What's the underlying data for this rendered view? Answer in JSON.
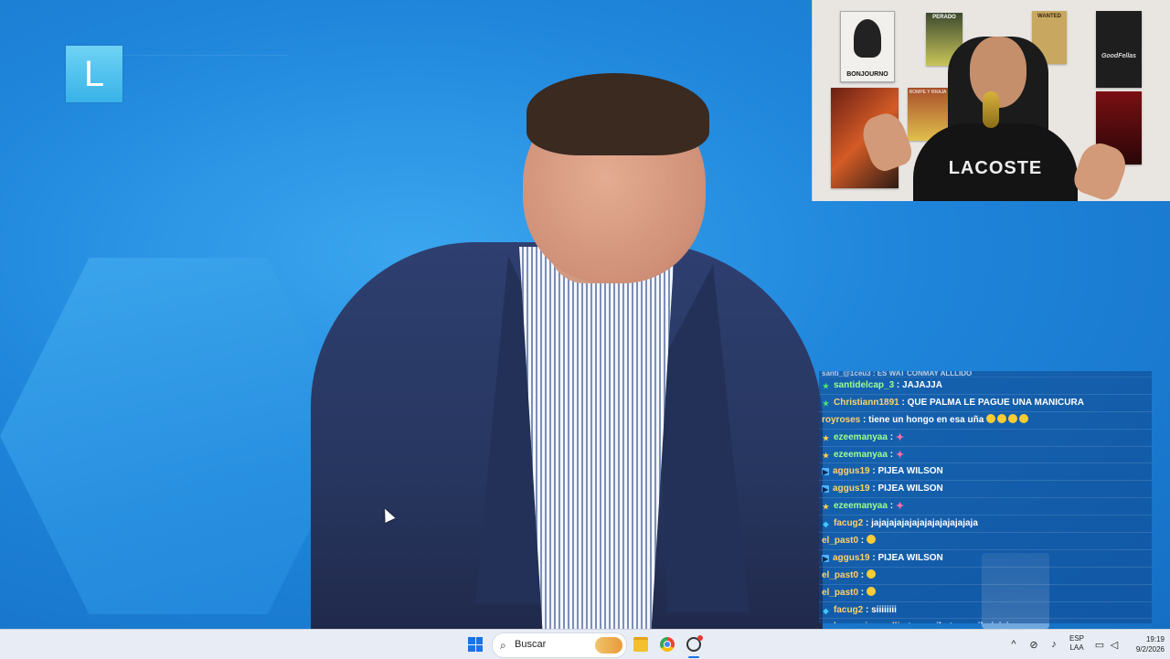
{
  "channel_logo": {
    "letter": "L"
  },
  "webcam": {
    "posters": [
      "BONJOURNO",
      "PERADO",
      "WANTED",
      "GoodFellas",
      "ROMPE Y RRAJA"
    ],
    "shirt_text": "LACOSTE"
  },
  "chat": {
    "partial_top": "santi_@1ceu3 : ES WAT CONMAY ALLLIDO",
    "messages": [
      {
        "badge": "star",
        "user": "santidelcap_3",
        "user_color": "#9fff8a",
        "text": "JAJAJJA",
        "emotes": 0
      },
      {
        "badge": "star",
        "user": "Christiann1891",
        "user_color": "#ffd36b",
        "text": "QUE PALMA LE PAGUE UNA MANICURA",
        "emotes": 0
      },
      {
        "badge": "",
        "user": "royroses",
        "user_color": "#ffd36b",
        "text": "tiene un hongo en esa uña",
        "emotes": 4
      },
      {
        "badge": "star2",
        "user": "ezeemanyaa",
        "user_color": "#9fff8a",
        "text": "",
        "emotes": 0,
        "pink_emote": "✦"
      },
      {
        "badge": "star2",
        "user": "ezeemanyaa",
        "user_color": "#9fff8a",
        "text": "",
        "emotes": 0,
        "pink_emote": "✦"
      },
      {
        "badge": "mod",
        "user": "aggus19",
        "user_color": "#ffd36b",
        "text": "PIJEA WILSON",
        "emotes": 0
      },
      {
        "badge": "mod",
        "user": "aggus19",
        "user_color": "#ffd36b",
        "text": "PIJEA WILSON",
        "emotes": 0
      },
      {
        "badge": "star2",
        "user": "ezeemanyaa",
        "user_color": "#9fff8a",
        "text": "",
        "emotes": 0,
        "pink_emote": "✦"
      },
      {
        "badge": "gem",
        "user": "facug2",
        "user_color": "#ffd36b",
        "text": "jajajajajajajajajajajajajaja",
        "emotes": 0
      },
      {
        "badge": "",
        "user": "el_past0",
        "user_color": "#ffd36b",
        "text": "",
        "emotes": 1
      },
      {
        "badge": "mod",
        "user": "aggus19",
        "user_color": "#ffd36b",
        "text": "PIJEA WILSON",
        "emotes": 0
      },
      {
        "badge": "",
        "user": "el_past0",
        "user_color": "#ffd36b",
        "text": "",
        "emotes": 1
      },
      {
        "badge": "",
        "user": "el_past0",
        "user_color": "#ffd36b",
        "text": "",
        "emotes": 1
      },
      {
        "badge": "gem",
        "user": "facug2",
        "user_color": "#ffd36b",
        "text": "siiiiiiii",
        "emotes": 0
      },
      {
        "badge": "warn",
        "user": "brunogianarelli",
        "user_color": "#ffd36b",
        "text": "tranquilo tranquilo jajaja",
        "emotes": 0
      }
    ],
    "separator": " : "
  },
  "taskbar": {
    "search_placeholder": "Buscar",
    "apps": [
      "file-explorer",
      "chrome",
      "obs-studio"
    ],
    "tray": {
      "chevron": "^",
      "lang_line1": "ESP",
      "lang_line2": "LAA",
      "time": "19:19",
      "date": "9/2/2026"
    }
  },
  "colors": {
    "studio_blue": "#1b78cc",
    "chat_bg": "rgba(14,70,140,.55)",
    "taskbar_bg": "#e8edf5",
    "accent": "#1a73e8"
  }
}
